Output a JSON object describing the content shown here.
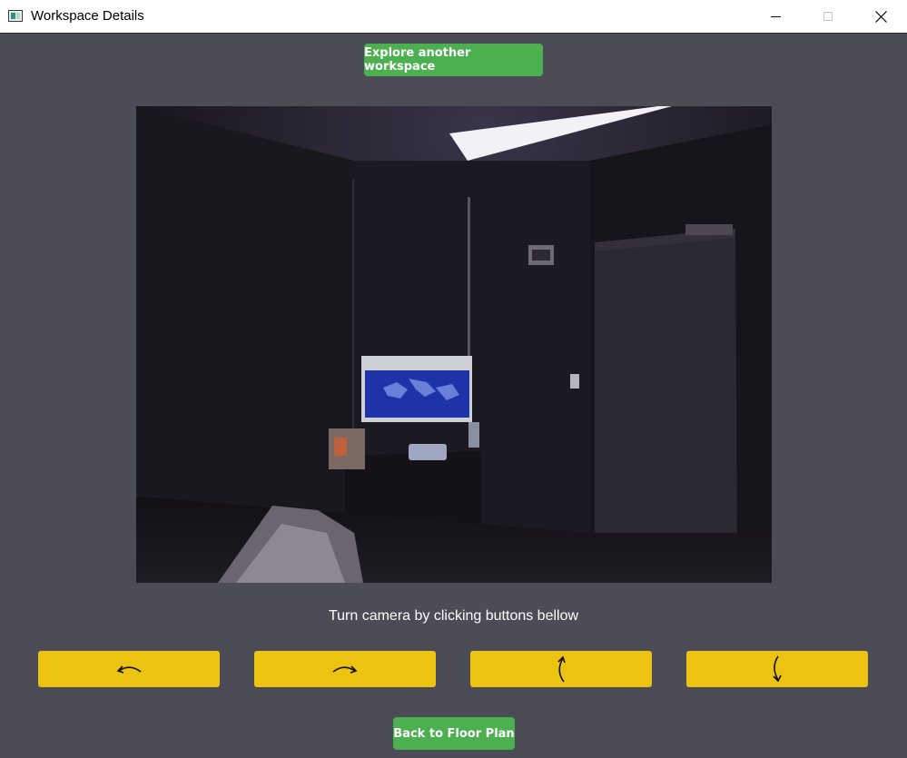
{
  "window": {
    "title": "Workspace Details"
  },
  "explore_button": {
    "label": "Explore another workspace"
  },
  "instruction": {
    "text": "Turn camera by clicking buttons bellow"
  },
  "turn_buttons": [
    {
      "icon": "rotate-left-arrow-icon"
    },
    {
      "icon": "rotate-right-arrow-icon"
    },
    {
      "icon": "rotate-up-arrow-icon"
    },
    {
      "icon": "rotate-down-arrow-icon"
    }
  ],
  "back_button": {
    "label": "Back to Floor Plan"
  },
  "colors": {
    "background": "#4b4c56",
    "green_button": "#4caf50",
    "yellow_button": "#ecc311"
  }
}
